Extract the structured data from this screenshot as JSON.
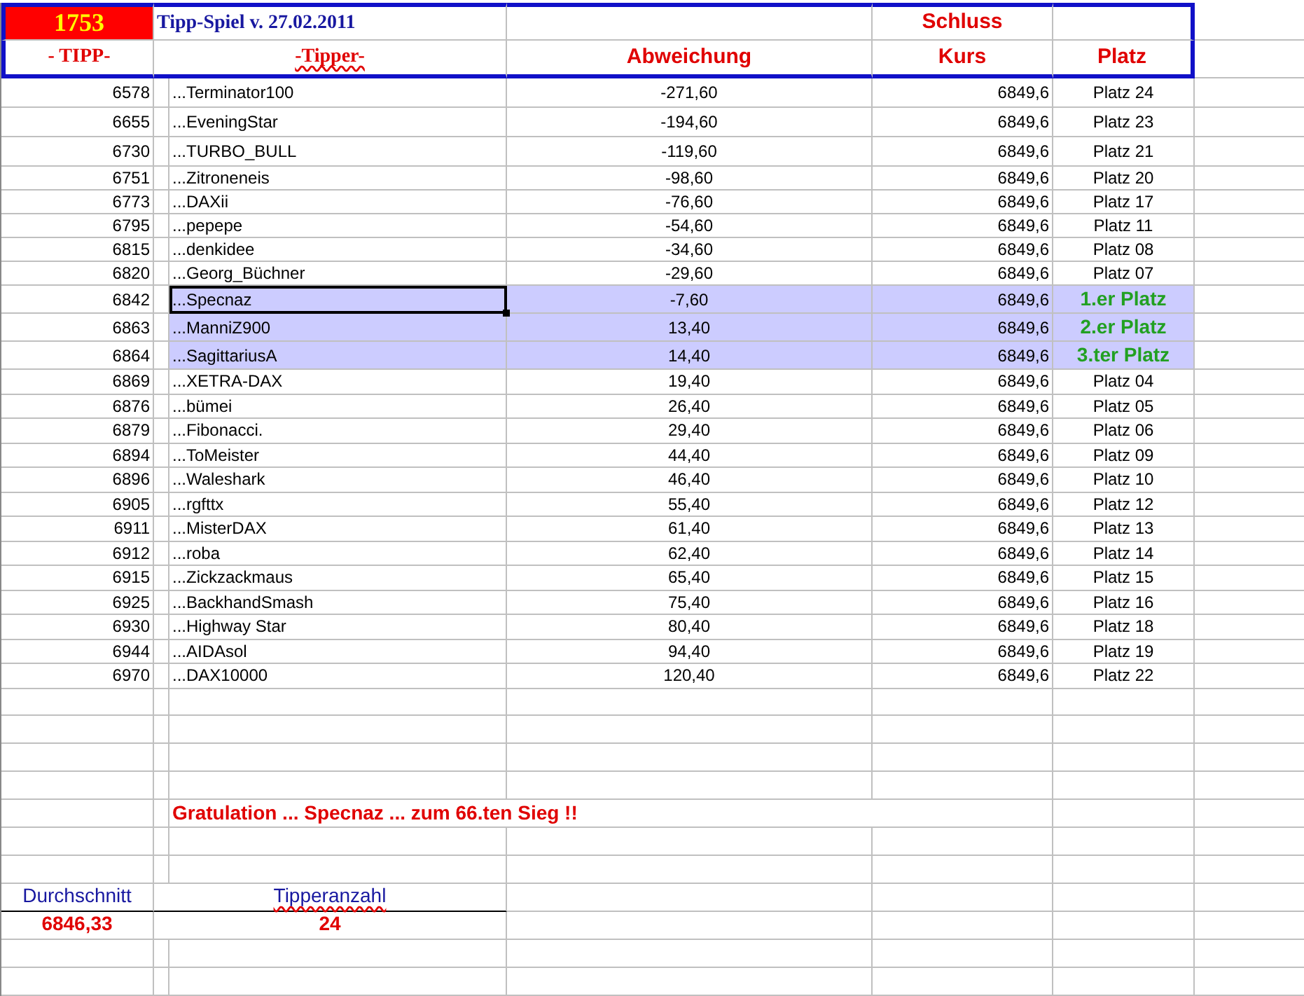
{
  "header": {
    "code": "1753",
    "title": "Tipp-Spiel v. 27.02.2011",
    "kurs_top": "Schluss"
  },
  "columns": [
    {
      "label": "- TIPP-",
      "spellcheck_flagged": false
    },
    {
      "label": "-Tipper-",
      "spellcheck_flagged": true
    },
    {
      "label": "Abweichung",
      "spellcheck_flagged": false
    },
    {
      "label": "Kurs",
      "spellcheck_flagged": false
    },
    {
      "label": "Platz",
      "spellcheck_flagged": false
    }
  ],
  "rows": [
    {
      "tipp": "6578",
      "tipper": "...Terminator100",
      "abweichung": "-271,60",
      "kurs": "6849,6",
      "platz": "Platz 24",
      "highlighted": false,
      "focused": false
    },
    {
      "tipp": "6655",
      "tipper": "...EveningStar",
      "abweichung": "-194,60",
      "kurs": "6849,6",
      "platz": "Platz 23",
      "highlighted": false,
      "focused": false
    },
    {
      "tipp": "6730",
      "tipper": "...TURBO_BULL",
      "abweichung": "-119,60",
      "kurs": "6849,6",
      "platz": "Platz 21",
      "highlighted": false,
      "focused": false
    },
    {
      "tipp": "6751",
      "tipper": "...Zitroneneis",
      "abweichung": "-98,60",
      "kurs": "6849,6",
      "platz": "Platz 20",
      "highlighted": false,
      "focused": false
    },
    {
      "tipp": "6773",
      "tipper": "...DAXii",
      "abweichung": "-76,60",
      "kurs": "6849,6",
      "platz": "Platz 17",
      "highlighted": false,
      "focused": false
    },
    {
      "tipp": "6795",
      "tipper": "...pepepe",
      "abweichung": "-54,60",
      "kurs": "6849,6",
      "platz": "Platz 11",
      "highlighted": false,
      "focused": false
    },
    {
      "tipp": "6815",
      "tipper": "...denkidee",
      "abweichung": "-34,60",
      "kurs": "6849,6",
      "platz": "Platz 08",
      "highlighted": false,
      "focused": false
    },
    {
      "tipp": "6820",
      "tipper": "...Georg_Büchner",
      "abweichung": "-29,60",
      "kurs": "6849,6",
      "platz": "Platz 07",
      "highlighted": false,
      "focused": false
    },
    {
      "tipp": "6842",
      "tipper": "...Specnaz",
      "abweichung": "-7,60",
      "kurs": "6849,6",
      "platz": "1.er Platz",
      "highlighted": true,
      "focused": true
    },
    {
      "tipp": "6863",
      "tipper": "...ManniZ900",
      "abweichung": "13,40",
      "kurs": "6849,6",
      "platz": "2.er Platz",
      "highlighted": true,
      "focused": false
    },
    {
      "tipp": "6864",
      "tipper": "...SagittariusA",
      "abweichung": "14,40",
      "kurs": "6849,6",
      "platz": "3.ter Platz",
      "highlighted": true,
      "focused": false
    },
    {
      "tipp": "6869",
      "tipper": "...XETRA-DAX",
      "abweichung": "19,40",
      "kurs": "6849,6",
      "platz": "Platz 04",
      "highlighted": false,
      "focused": false
    },
    {
      "tipp": "6876",
      "tipper": "...bümei",
      "abweichung": "26,40",
      "kurs": "6849,6",
      "platz": "Platz 05",
      "highlighted": false,
      "focused": false
    },
    {
      "tipp": "6879",
      "tipper": "...Fibonacci.",
      "abweichung": "29,40",
      "kurs": "6849,6",
      "platz": "Platz 06",
      "highlighted": false,
      "focused": false
    },
    {
      "tipp": "6894",
      "tipper": "...ToMeister",
      "abweichung": "44,40",
      "kurs": "6849,6",
      "platz": "Platz 09",
      "highlighted": false,
      "focused": false
    },
    {
      "tipp": "6896",
      "tipper": "...Waleshark",
      "abweichung": "46,40",
      "kurs": "6849,6",
      "platz": "Platz 10",
      "highlighted": false,
      "focused": false
    },
    {
      "tipp": "6905",
      "tipper": "...rgfttx",
      "abweichung": "55,40",
      "kurs": "6849,6",
      "platz": "Platz 12",
      "highlighted": false,
      "focused": false
    },
    {
      "tipp": "6911",
      "tipper": "...MisterDAX",
      "abweichung": "61,40",
      "kurs": "6849,6",
      "platz": "Platz 13",
      "highlighted": false,
      "focused": false
    },
    {
      "tipp": "6912",
      "tipper": "...roba",
      "abweichung": "62,40",
      "kurs": "6849,6",
      "platz": "Platz 14",
      "highlighted": false,
      "focused": false
    },
    {
      "tipp": "6915",
      "tipper": "...Zickzackmaus",
      "abweichung": "65,40",
      "kurs": "6849,6",
      "platz": "Platz 15",
      "highlighted": false,
      "focused": false
    },
    {
      "tipp": "6925",
      "tipper": "...BackhandSmash",
      "abweichung": "75,40",
      "kurs": "6849,6",
      "platz": "Platz 16",
      "highlighted": false,
      "focused": false
    },
    {
      "tipp": "6930",
      "tipper": "...Highway Star",
      "abweichung": "80,40",
      "kurs": "6849,6",
      "platz": "Platz 18",
      "highlighted": false,
      "focused": false
    },
    {
      "tipp": "6944",
      "tipper": "...AIDAsol",
      "abweichung": "94,40",
      "kurs": "6849,6",
      "platz": "Platz 19",
      "highlighted": false,
      "focused": false
    },
    {
      "tipp": "6970",
      "tipper": "...DAX10000",
      "abweichung": "120,40",
      "kurs": "6849,6",
      "platz": "Platz 22",
      "highlighted": false,
      "focused": false
    }
  ],
  "message": "Gratulation ... Specnaz ... zum 66.ten Sieg !!",
  "summary": [
    {
      "label": "Durchschnitt",
      "value": "6846,33",
      "spellcheck_flagged": false
    },
    {
      "label": "Tipperanzahl",
      "value": "24",
      "spellcheck_flagged": true
    }
  ]
}
